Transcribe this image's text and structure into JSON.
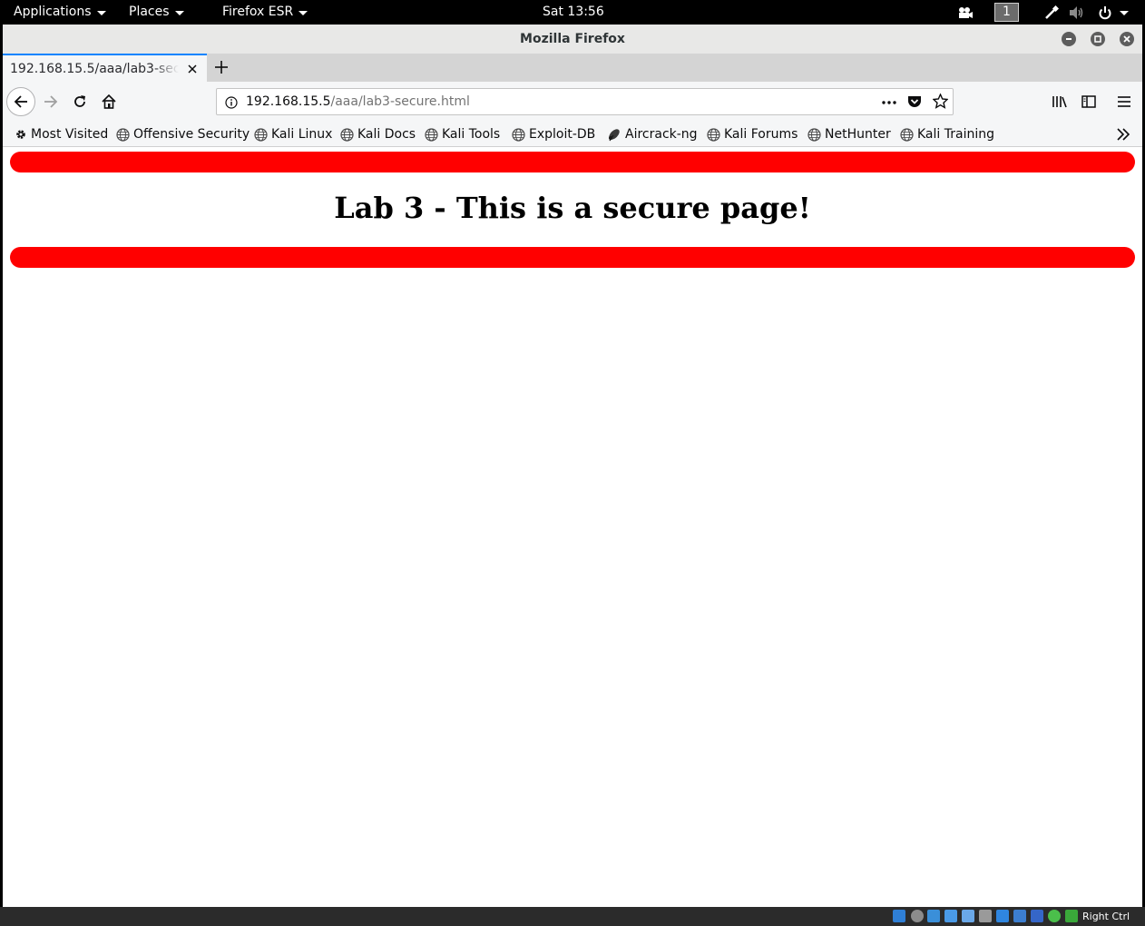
{
  "topbar": {
    "applications": "Applications",
    "places": "Places",
    "app_menu": "Firefox ESR",
    "clock": "Sat 13:56",
    "workspace": "1"
  },
  "window": {
    "title": "Mozilla Firefox"
  },
  "tabs": [
    {
      "title": "192.168.15.5/aaa/lab3-secure.html",
      "active": true
    }
  ],
  "urlbar": {
    "host": "192.168.15.5",
    "path": "/aaa/lab3-secure.html"
  },
  "bookmarks": [
    {
      "label": "Most Visited",
      "icon": "gear-icon"
    },
    {
      "label": "Offensive Security",
      "icon": "globe-icon"
    },
    {
      "label": "Kali Linux",
      "icon": "globe-icon"
    },
    {
      "label": "Kali Docs",
      "icon": "globe-icon"
    },
    {
      "label": "Kali Tools",
      "icon": "globe-icon"
    },
    {
      "label": "Exploit-DB",
      "icon": "globe-icon"
    },
    {
      "label": "Aircrack-ng",
      "icon": "aircrack-icon"
    },
    {
      "label": "Kali Forums",
      "icon": "globe-icon"
    },
    {
      "label": "NetHunter",
      "icon": "globe-icon"
    },
    {
      "label": "Kali Training",
      "icon": "globe-icon"
    }
  ],
  "page": {
    "heading": "Lab 3 - This is a secure page!",
    "bar_color": "#ff0000"
  },
  "vbox": {
    "host_key": "Right Ctrl"
  }
}
